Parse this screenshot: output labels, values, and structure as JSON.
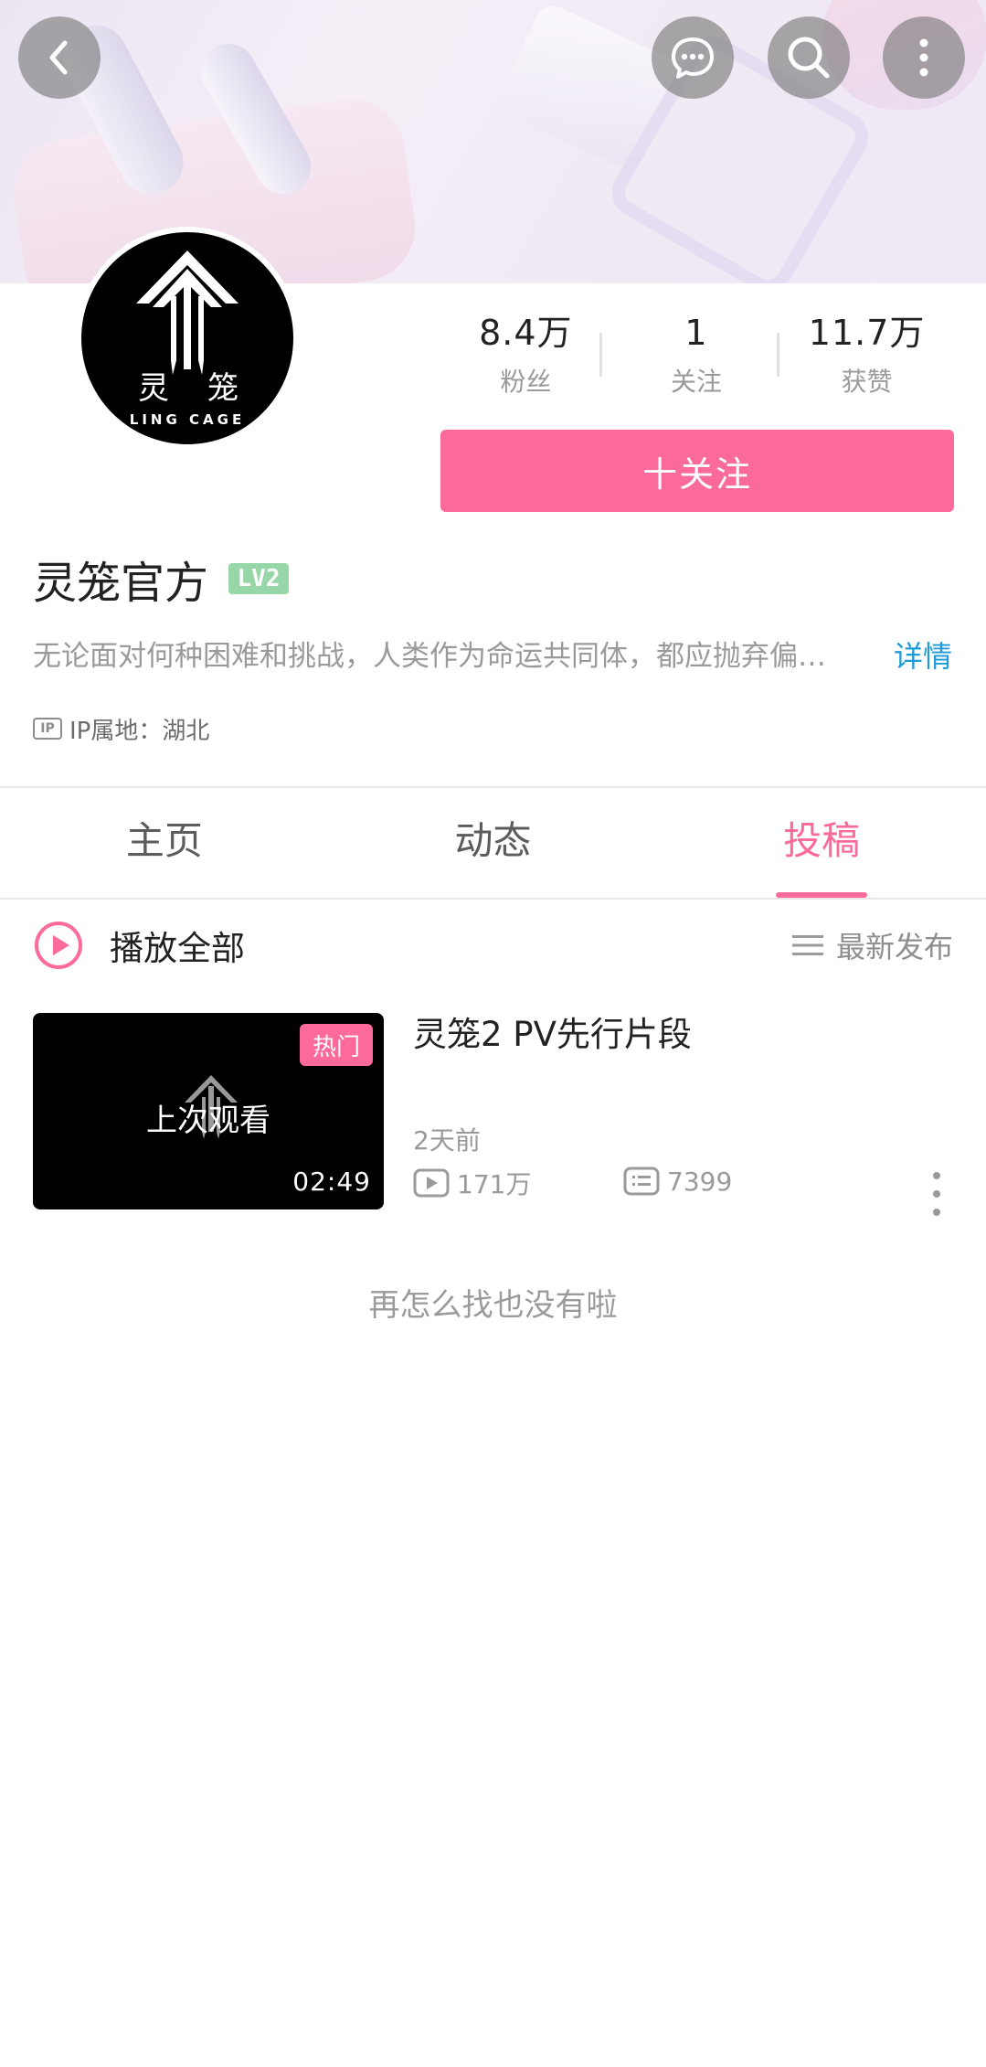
{
  "header": {
    "back_icon": "chevron-left-icon",
    "message_icon": "chat-bubble-icon",
    "search_icon": "search-icon",
    "more_icon": "more-vertical-icon"
  },
  "profile": {
    "avatar_text": {
      "char1": "灵",
      "char2": "笼",
      "subtitle": "LING CAGE"
    },
    "stats": [
      {
        "value": "8.4万",
        "label": "粉丝"
      },
      {
        "value": "1",
        "label": "关注"
      },
      {
        "value": "11.7万",
        "label": "获赞"
      }
    ],
    "follow_label": "十关注",
    "name": "灵笼官方",
    "level": "LV2",
    "bio": "无论面对何种困难和挑战，人类作为命运共同体，都应抛弃偏…",
    "detail_label": "详情",
    "ip_badge": "IP",
    "ip_text": "IP属地：湖北"
  },
  "tabs": [
    {
      "label": "主页",
      "active": false
    },
    {
      "label": "动态",
      "active": false
    },
    {
      "label": "投稿",
      "active": true
    }
  ],
  "list_header": {
    "play_all": "播放全部",
    "sort": "最新发布"
  },
  "videos": [
    {
      "title": "灵笼2 PV先行片段",
      "badge": "热门",
      "overlay": "上次观看",
      "duration": "02:49",
      "time": "2天前",
      "plays": "171万",
      "comments": "7399"
    }
  ],
  "end_text": "再怎么找也没有啦",
  "colors": {
    "accent": "#fb6a9a",
    "link": "#1e9bd7",
    "level_badge": "#97d7a7"
  }
}
